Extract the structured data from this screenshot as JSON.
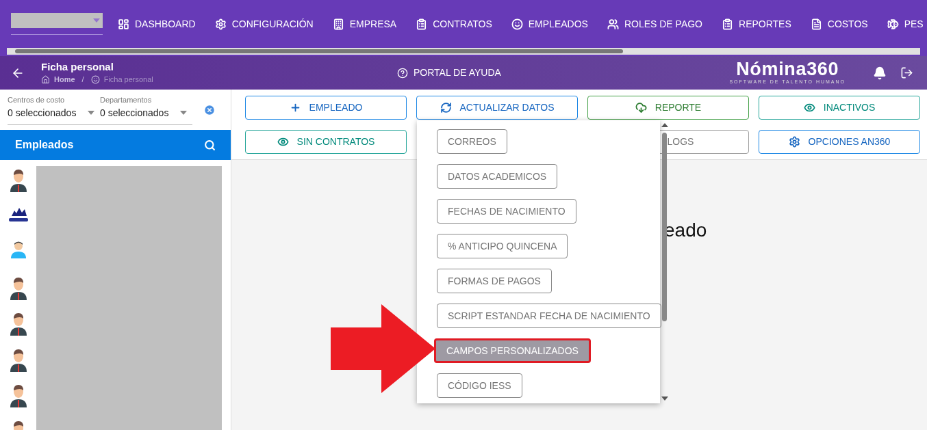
{
  "top_nav": {
    "items": [
      {
        "label": "DASHBOARD"
      },
      {
        "label": "CONFIGURACIÓN"
      },
      {
        "label": "EMPRESA"
      },
      {
        "label": "CONTRATOS"
      },
      {
        "label": "EMPLEADOS"
      },
      {
        "label": "ROLES DE PAGO"
      },
      {
        "label": "REPORTES"
      },
      {
        "label": "COSTOS"
      },
      {
        "label": "PES"
      }
    ]
  },
  "header": {
    "title": "Ficha personal",
    "breadcrumb": [
      "Home",
      "Ficha personal"
    ],
    "breadcrumb_separator": "/",
    "help": "PORTAL DE AYUDA",
    "logo": "Nómina360",
    "logo_tagline": "SOFTWARE DE TALENTO HUMANO"
  },
  "filters": [
    {
      "label": "Centros de costo",
      "value": "0 seleccionados"
    },
    {
      "label": "Departamentos",
      "value": "0 seleccionados"
    }
  ],
  "employees_panel": {
    "title": "Empleados",
    "avatars": [
      {
        "kind": "person"
      },
      {
        "kind": "logo"
      },
      {
        "kind": "agent"
      },
      {
        "kind": "person"
      },
      {
        "kind": "person"
      },
      {
        "kind": "person"
      },
      {
        "kind": "person"
      },
      {
        "kind": "person"
      }
    ]
  },
  "actions": [
    {
      "label": "EMPLEADO"
    },
    {
      "label": "ACTUALIZAR DATOS"
    },
    {
      "label": "REPORTE"
    },
    {
      "label": "INACTIVOS"
    },
    {
      "label": "SIN CONTRATOS"
    },
    {
      "label": "LOGS"
    },
    {
      "label": "OPCIONES AN360"
    }
  ],
  "main_text": "eado",
  "dropdown": {
    "items": [
      {
        "label": "CORREOS",
        "selected": false
      },
      {
        "label": "DATOS ACADEMICOS",
        "selected": false
      },
      {
        "label": "FECHAS DE NACIMIENTO",
        "selected": false
      },
      {
        "label": "% ANTICIPO QUINCENA",
        "selected": false
      },
      {
        "label": "FORMAS DE PAGOS",
        "selected": false
      },
      {
        "label": "SCRIPT ESTANDAR FECHA DE NACIMIENTO",
        "selected": false
      },
      {
        "label": "CAMPOS PERSONALIZADOS",
        "selected": true
      },
      {
        "label": "CÓDIGO IESS",
        "selected": false
      }
    ]
  }
}
